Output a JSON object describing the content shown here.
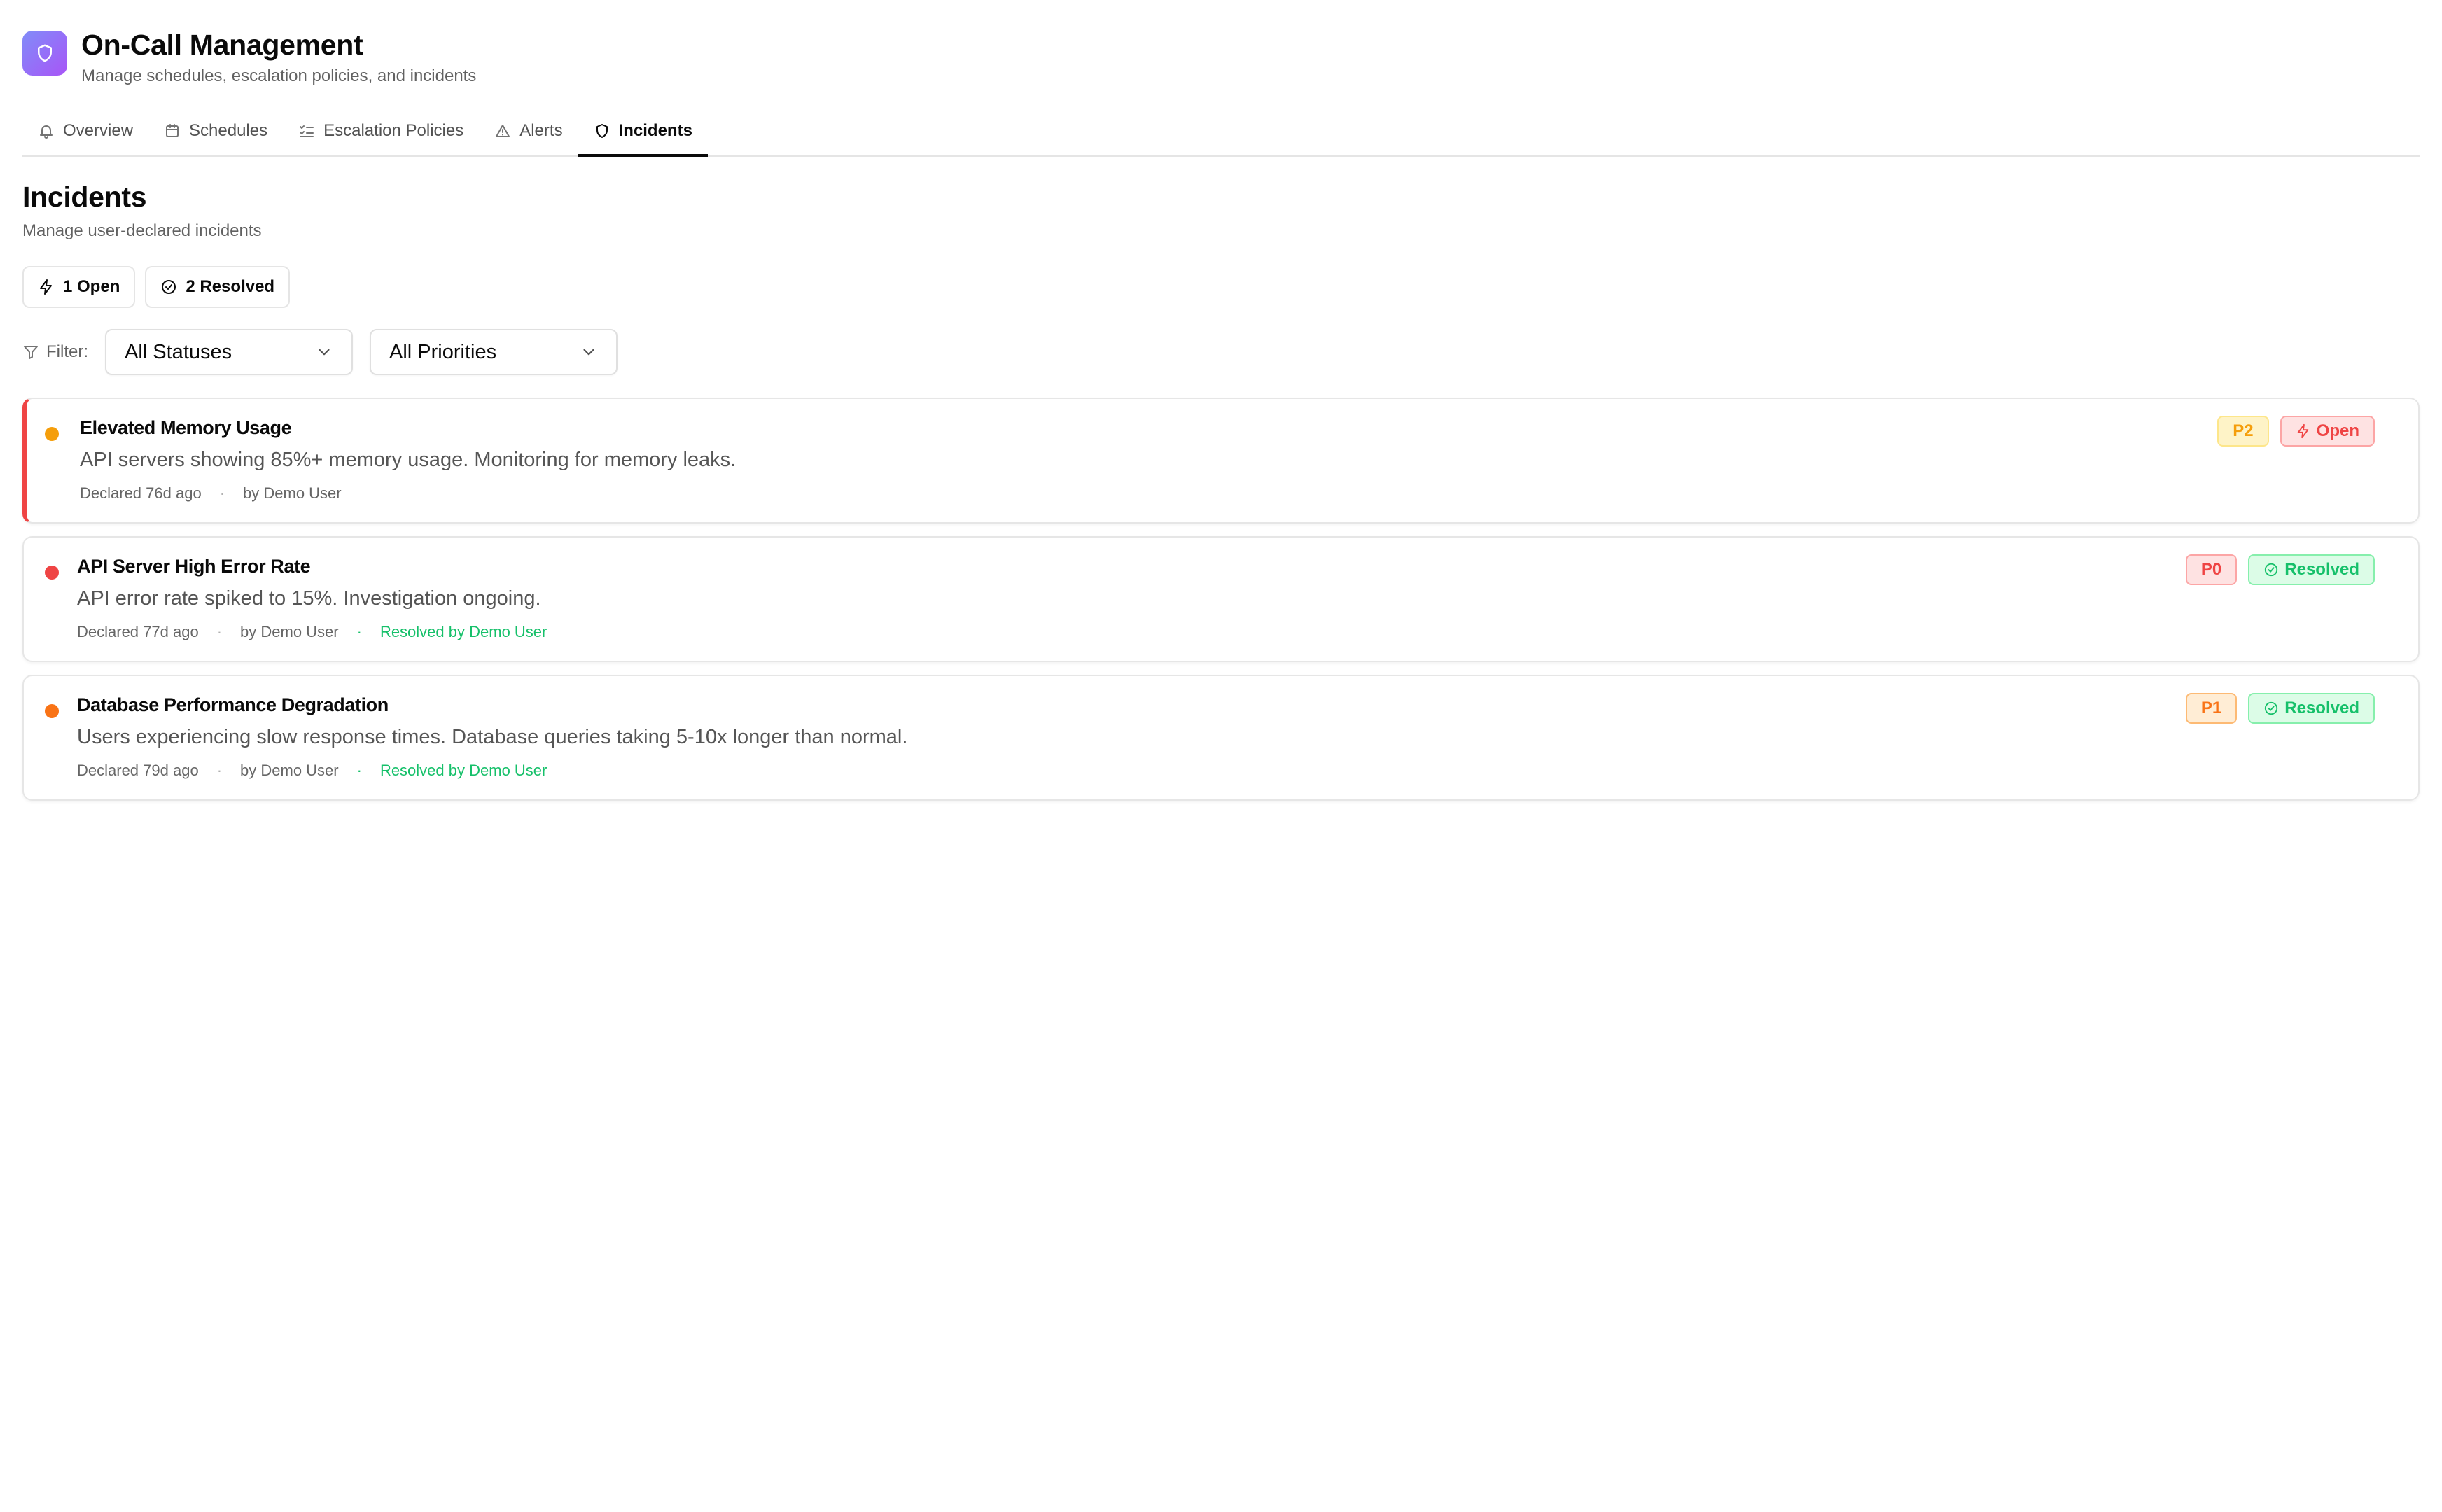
{
  "header": {
    "title": "On-Call Management",
    "subtitle": "Manage schedules, escalation policies, and incidents",
    "logo_icon": "shield-icon"
  },
  "tabs": [
    {
      "label": "Overview",
      "icon": "bell-icon",
      "active": false
    },
    {
      "label": "Schedules",
      "icon": "calendar-icon",
      "active": false
    },
    {
      "label": "Escalation Policies",
      "icon": "list-checks-icon",
      "active": false
    },
    {
      "label": "Alerts",
      "icon": "warning-triangle-icon",
      "active": false
    },
    {
      "label": "Incidents",
      "icon": "shield-icon",
      "active": true
    }
  ],
  "section": {
    "title": "Incidents",
    "subtitle": "Manage user-declared incidents"
  },
  "counts": {
    "open_label": "1 Open",
    "resolved_label": "2 Resolved"
  },
  "filters": {
    "label": "Filter:",
    "status_value": "All Statuses",
    "priority_value": "All Priorities"
  },
  "incidents": [
    {
      "title": "Elevated Memory Usage",
      "description": "API servers showing 85%+ memory usage. Monitoring for memory leaks.",
      "declared": "Declared 76d ago",
      "by": "by Demo User",
      "resolved_by": "",
      "priority": "P2",
      "status": "Open",
      "dot_color": "#f59e0b"
    },
    {
      "title": "API Server High Error Rate",
      "description": "API error rate spiked to 15%. Investigation ongoing.",
      "declared": "Declared 77d ago",
      "by": "by Demo User",
      "resolved_by": "Resolved by Demo User",
      "priority": "P0",
      "status": "Resolved",
      "dot_color": "#ef4444"
    },
    {
      "title": "Database Performance Degradation",
      "description": "Users experiencing slow response times. Database queries taking 5-10x longer than normal.",
      "declared": "Declared 79d ago",
      "by": "by Demo User",
      "resolved_by": "Resolved by Demo User",
      "priority": "P1",
      "status": "Resolved",
      "dot_color": "#f97316"
    }
  ],
  "colors": {
    "open_accent": "#ef4444",
    "resolved_green": "#16c06a",
    "p0": "#ef4444",
    "p1": "#f97316",
    "p2": "#f59e0b"
  }
}
